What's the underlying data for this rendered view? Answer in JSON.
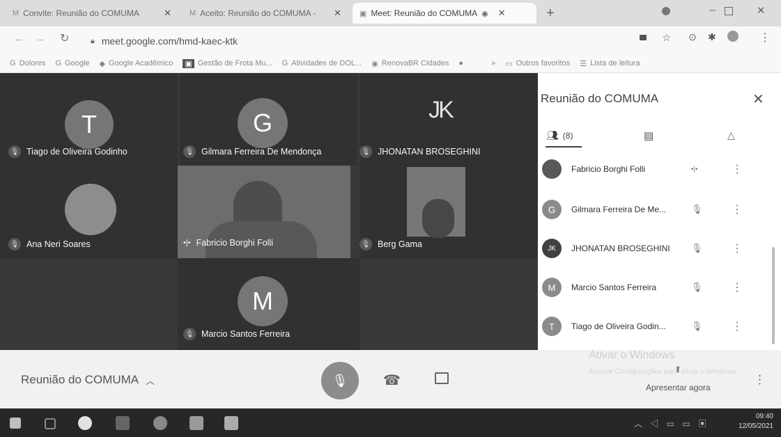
{
  "browser": {
    "tabs": [
      {
        "label": "Convite: Reunião do COMUMA",
        "active": false
      },
      {
        "label": "Aceito: Reunião do COMUMA -",
        "active": false
      },
      {
        "label": "Meet: Reunião do COMUMA",
        "active": true
      }
    ],
    "new_tab": "+",
    "url": "meet.google.com/hmd-kaec-ktk",
    "bookmarks": [
      "Dolores",
      "Google",
      "Google Acadêmico",
      "Gestão de Frota Mu...",
      "Atividades de DOL...",
      "RenovaBR Cidades"
    ],
    "bookmarks_more": "»",
    "other_favorites": "Outros favoritos",
    "reading_list": "Lista de leitura"
  },
  "tiles": [
    {
      "initial": "T",
      "name": "Tiago de Oliveira Godinho"
    },
    {
      "initial": "G",
      "name": "Gilmara Ferreira De Mendonça"
    },
    {
      "initial": "",
      "name": "JHONATAN BROSEGHINI"
    },
    {
      "initial": "",
      "name": "Ana Neri Soares"
    },
    {
      "initial": "",
      "name": "Fabricio Borghi Folli"
    },
    {
      "initial": "",
      "name": "Berg Gama"
    },
    {
      "initial": "M",
      "name": "Marcio Santos Ferreira"
    }
  ],
  "panel": {
    "title": "Reunião do COMUMA",
    "people_count": "(8)",
    "participants": [
      {
        "initial": "",
        "name": "Fabricio Borghi Folli"
      },
      {
        "initial": "G",
        "name": "Gilmara Ferreira De Me..."
      },
      {
        "initial": "",
        "name": "JHONATAN BROSEGHINI"
      },
      {
        "initial": "M",
        "name": "Marcio Santos Ferreira"
      },
      {
        "initial": "T",
        "name": "Tiago de Oliveira Godin..."
      }
    ]
  },
  "bottom": {
    "meeting_title": "Reunião do COMUMA",
    "activate_windows": "Ativar o Windows",
    "activate_sub": "Acesse Configurações para ativar o Windows.",
    "present_now": "Apresentar agora"
  },
  "taskbar": {
    "time": "09:40",
    "date": "12/05/2021"
  }
}
